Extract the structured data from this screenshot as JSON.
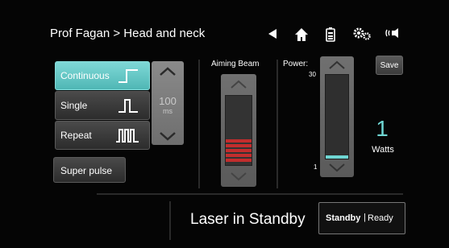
{
  "header": {
    "breadcrumb": "Prof  Fagan > Head and neck",
    "icons": [
      "back-arrow-icon",
      "home-icon",
      "battery-icon",
      "settings-icon",
      "sound-icon"
    ]
  },
  "modes": {
    "continuous": "Continuous",
    "single": "Single",
    "repeat": "Repeat",
    "selected": "Continuous"
  },
  "duration": {
    "value": "100",
    "unit": "ms"
  },
  "super_pulse": "Super pulse",
  "aiming_beam": {
    "label": "Aiming Beam",
    "level_bars": 5,
    "level_total": 14
  },
  "power": {
    "label": "Power:",
    "max": "30",
    "min": "1",
    "value": "1",
    "unit": "Watts",
    "fill_fraction": 0.04
  },
  "save_label": "Save",
  "status": {
    "text": "Laser in Standby",
    "standby": "Standby",
    "separator": "|",
    "ready": "Ready"
  },
  "colors": {
    "accent": "#6fd6d3",
    "aim_bar": "#c32d2d"
  }
}
